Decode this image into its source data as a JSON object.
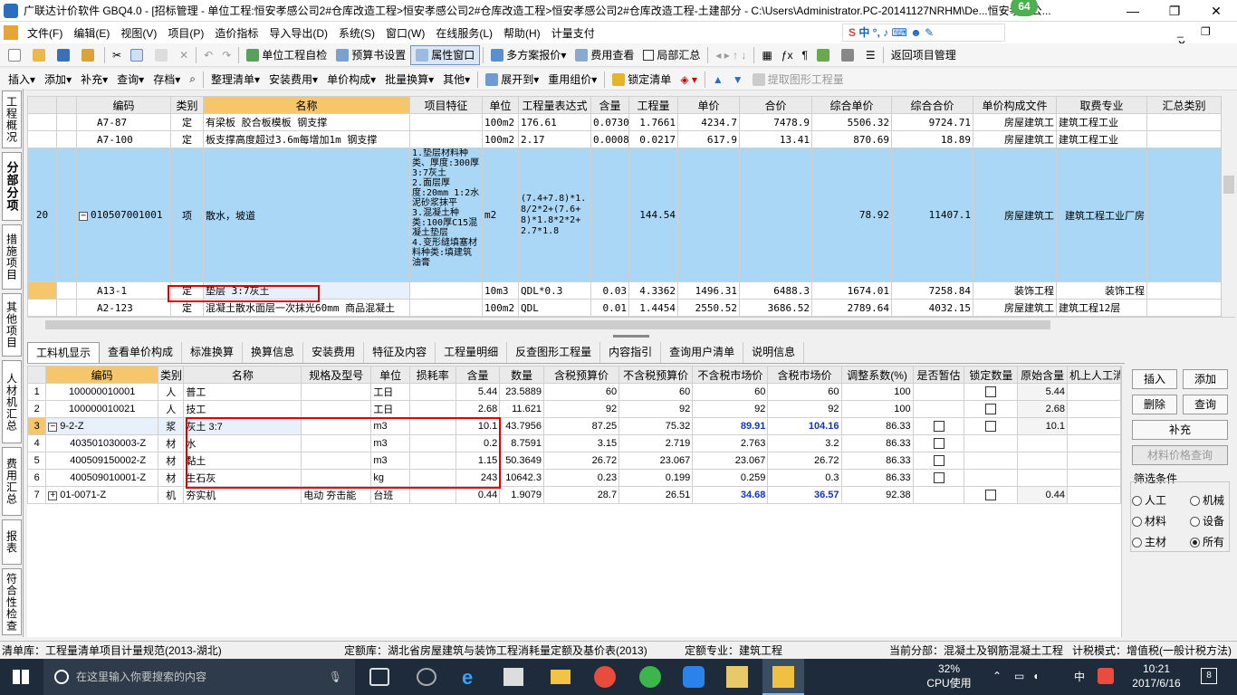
{
  "title": "广联达计价软件 GBQ4.0 - [招标管理 - 单位工程:恒安孝感公司2#仓库改造工程>恒安孝感公司2#仓库改造工程>恒安孝感公司2#仓库改造工程-土建部分 - C:\\Users\\Administrator.PC-20141127NRHM\\De...恒安孝感公...",
  "badge": "64",
  "menu": [
    "文件(F)",
    "编辑(E)",
    "视图(V)",
    "项目(P)",
    "造价指标",
    "导入导出(D)",
    "系统(S)",
    "窗口(W)",
    "在线服务(L)",
    "帮助(H)",
    "计量支付"
  ],
  "toolbar1": [
    "单位工程自检",
    "预算书设置",
    "属性窗口",
    "多方案报价",
    "费用查看",
    "局部汇总",
    "返回项目管理"
  ],
  "toolbar2": [
    "插入",
    "添加",
    "补充",
    "查询",
    "存档",
    "整理清单",
    "安装费用",
    "单价构成",
    "批量换算",
    "其他",
    "展开到",
    "重用组价",
    "锁定清单",
    "提取图形工程量"
  ],
  "lefttabs": [
    "工程概况",
    "分部分项",
    "措施项目",
    "其他项目",
    "人材机汇总",
    "费用汇总",
    "报表",
    "符合性检查"
  ],
  "grid1": {
    "headers": [
      "编码",
      "类别",
      "名称",
      "项目特征",
      "单位",
      "工程量表达式",
      "含量",
      "工程量",
      "单价",
      "合价",
      "综合单价",
      "综合合价",
      "单价构成文件",
      "取费专业",
      "汇总类别"
    ],
    "rows": [
      {
        "no": "",
        "code": "A7-87",
        "type": "定",
        "name": "有梁板 胶合板模板 钢支撑",
        "feature": "",
        "unit": "100m2",
        "expr": "176.61",
        "content": "0.0730",
        "qty": "1.7661",
        "price": "4234.7",
        "total": "7478.9",
        "uprice": "5506.32",
        "utotal": "9724.71",
        "file": "房屋建筑工",
        "spec": "建筑工程工业",
        "sum": ""
      },
      {
        "no": "",
        "code": "A7-100",
        "type": "定",
        "name": "板支撑高度超过3.6m每增加1m 钢支撑",
        "feature": "",
        "unit": "100m2",
        "expr": "2.17",
        "content": "0.0008",
        "qty": "0.0217",
        "price": "617.9",
        "total": "13.41",
        "uprice": "870.69",
        "utotal": "18.89",
        "file": "房屋建筑工",
        "spec": "建筑工程工业",
        "sum": ""
      },
      {
        "no": "20",
        "code": "010507001001",
        "type": "项",
        "name": "散水，坡道",
        "feature": "1.垫层材料种类、厚度:300厚3:7灰土\n2.面层厚度:20mm 1:2水泥砂浆抹平\n3.混凝土种类:100厚C15混凝土垫层\n4.变形缝填塞材料种类:填建筑油膏",
        "unit": "m2",
        "expr": "(7.4+7.8)*1.8/2*2+(7.6+8)*1.8*2*2+2.7*1.8",
        "content": "",
        "qty": "144.54",
        "price": "",
        "total": "",
        "uprice": "78.92",
        "utotal": "11407.1",
        "file": "房屋建筑工",
        "spec": "建筑工程工业厂房",
        "sum": ""
      },
      {
        "no": "",
        "code": "A13-1",
        "type": "定",
        "name": "垫层 3:7灰土",
        "feature": "",
        "unit": "10m3",
        "expr": "QDL*0.3",
        "content": "0.03",
        "qty": "4.3362",
        "price": "1496.31",
        "total": "6488.3",
        "uprice": "1674.01",
        "utotal": "7258.84",
        "file": "装饰工程",
        "spec": "装饰工程",
        "sum": ""
      },
      {
        "no": "",
        "code": "A2-123",
        "type": "定",
        "name": "混凝土散水面层一次抹光60mm 商品混凝土",
        "feature": "",
        "unit": "100m2",
        "expr": "QDL",
        "content": "0.01",
        "qty": "1.4454",
        "price": "2550.52",
        "total": "3686.52",
        "uprice": "2789.64",
        "utotal": "4032.15",
        "file": "房屋建筑工",
        "spec": "建筑工程12层",
        "sum": ""
      }
    ]
  },
  "tabs2": [
    "工料机显示",
    "查看单价构成",
    "标准换算",
    "换算信息",
    "安装费用",
    "特征及内容",
    "工程量明细",
    "反查图形工程量",
    "内容指引",
    "查询用户清单",
    "说明信息"
  ],
  "grid2": {
    "headers": [
      "编码",
      "类别",
      "名称",
      "规格及型号",
      "单位",
      "损耗率",
      "含量",
      "数量",
      "含税预算价",
      "不含税预算价",
      "不含税市场价",
      "含税市场价",
      "调整系数(%)",
      "是否暂估",
      "锁定数量",
      "原始含量",
      "机上人工消"
    ],
    "rows": [
      {
        "no": "1",
        "code": "100000010001",
        "type": "人",
        "name": "普工",
        "model": "",
        "unit": "工日",
        "loss": "",
        "content": "5.44",
        "qty": "23.5889",
        "p1": "60",
        "p2": "60",
        "p3": "60",
        "p4": "60",
        "coef": "100",
        "est": false,
        "lock": true,
        "orig": "5.44"
      },
      {
        "no": "2",
        "code": "100000010021",
        "type": "人",
        "name": "技工",
        "model": "",
        "unit": "工日",
        "loss": "",
        "content": "2.68",
        "qty": "11.621",
        "p1": "92",
        "p2": "92",
        "p3": "92",
        "p4": "92",
        "coef": "100",
        "est": false,
        "lock": true,
        "orig": "2.68"
      },
      {
        "no": "3",
        "code": "9-2-Z",
        "type": "浆",
        "name": "灰土 3:7",
        "model": "",
        "unit": "m3",
        "loss": "",
        "content": "10.1",
        "qty": "43.7956",
        "p1": "87.25",
        "p2": "75.32",
        "p3": "89.91",
        "p4": "104.16",
        "coef": "86.33",
        "est": true,
        "lock": true,
        "orig": "10.1"
      },
      {
        "no": "4",
        "code": "403501030003-Z",
        "type": "材",
        "name": "水",
        "model": "",
        "unit": "m3",
        "loss": "",
        "content": "0.2",
        "qty": "8.7591",
        "p1": "3.15",
        "p2": "2.719",
        "p3": "2.763",
        "p4": "3.2",
        "coef": "86.33",
        "est": true,
        "lock": false,
        "orig": ""
      },
      {
        "no": "5",
        "code": "400509150002-Z",
        "type": "材",
        "name": "黏土",
        "model": "",
        "unit": "m3",
        "loss": "",
        "content": "1.15",
        "qty": "50.3649",
        "p1": "26.72",
        "p2": "23.067",
        "p3": "23.067",
        "p4": "26.72",
        "coef": "86.33",
        "est": true,
        "lock": false,
        "orig": ""
      },
      {
        "no": "6",
        "code": "400509010001-Z",
        "type": "材",
        "name": "生石灰",
        "model": "",
        "unit": "kg",
        "loss": "",
        "content": "243",
        "qty": "10642.3",
        "p1": "0.23",
        "p2": "0.199",
        "p3": "0.259",
        "p4": "0.3",
        "coef": "86.33",
        "est": true,
        "lock": false,
        "orig": ""
      },
      {
        "no": "7",
        "code": "01-0071-Z",
        "type": "机",
        "name": "夯实机",
        "model": "电动 夯击能",
        "unit": "台班",
        "loss": "",
        "content": "0.44",
        "qty": "1.9079",
        "p1": "28.7",
        "p2": "26.51",
        "p3": "34.68",
        "p4": "36.57",
        "coef": "92.38",
        "est": false,
        "lock": true,
        "orig": "0.44"
      }
    ]
  },
  "right_panel": {
    "insert": "插入",
    "add": "添加",
    "delete": "删除",
    "query": "查询",
    "supplement": "补充",
    "price_query": "材料价格查询",
    "filter_title": "筛选条件",
    "filters": [
      "人工",
      "机械",
      "材料",
      "设备",
      "主材",
      "所有"
    ]
  },
  "status": {
    "list_lib": "清单库：工程量清单项目计量规范(2013-湖北)",
    "quota_lib": "定额库：湖北省房屋建筑与装饰工程消耗量定额及基价表(2013)",
    "quota_spec": "定额专业：建筑工程",
    "current": "当前分部：混凝土及钢筋混凝土工程",
    "tax_mode": "计税模式：增值税(一般计税方法)"
  },
  "taskbar": {
    "search": "在这里输入你要搜索的内容",
    "cpu": "32%",
    "cpu_label": "CPU使用",
    "ime": "中",
    "time": "10:21",
    "date": "2017/6/16",
    "notif": "8"
  }
}
